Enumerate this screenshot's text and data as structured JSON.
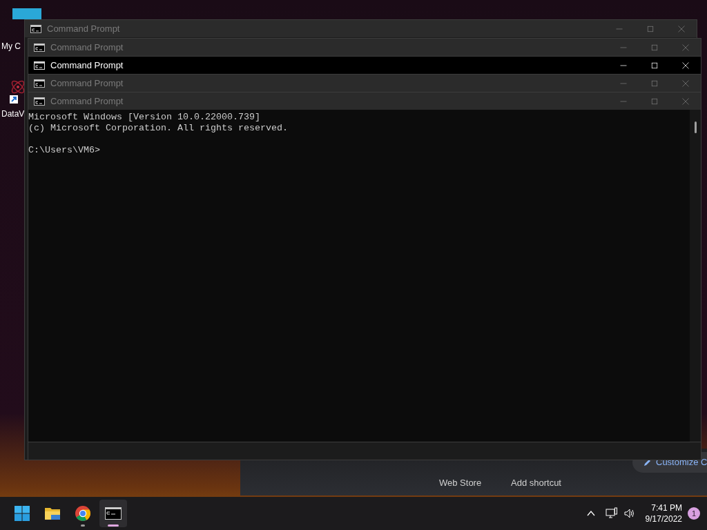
{
  "desktop_icons": [
    {
      "label": "My C"
    },
    {
      "label": "DataV"
    }
  ],
  "background_window": {
    "tiles": [
      "Web Store",
      "Add shortcut"
    ],
    "customize": "Customize C"
  },
  "windows": [
    {
      "title": "Command Prompt",
      "active": false
    },
    {
      "title": "Command Prompt",
      "active": false
    },
    {
      "title": "Command Prompt",
      "active": true
    },
    {
      "title": "Command Prompt",
      "active": false
    },
    {
      "title": "Command Prompt",
      "active": false
    }
  ],
  "console": {
    "banner": [
      "Microsoft Windows [Version 10.0.22000.739]",
      "(c) Microsoft Corporation. All rights reserved."
    ],
    "prompt": "C:\\Users\\VM6>"
  },
  "taskbar": {
    "apps": [
      {
        "kind": "start",
        "running": false,
        "selected": false
      },
      {
        "kind": "explorer",
        "running": false,
        "selected": false
      },
      {
        "kind": "chrome",
        "running": true,
        "selected": false
      },
      {
        "kind": "terminal",
        "running": true,
        "selected": true
      }
    ],
    "time": "7:41 PM",
    "date": "9/17/2022",
    "notification_count": "1"
  }
}
